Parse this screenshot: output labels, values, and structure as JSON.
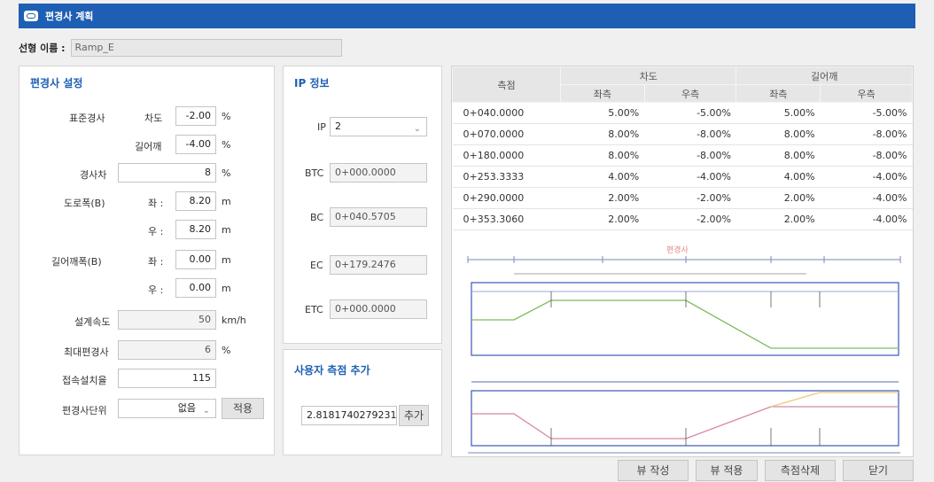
{
  "window": {
    "title": "편경사 계획",
    "icon": "app-logo-icon"
  },
  "route": {
    "label": "선형 이름 :",
    "value": "Ramp_E"
  },
  "settings": {
    "title": "편경사 설정",
    "standard_slope_label": "표준경사",
    "lane_label": "차도",
    "lane_value": "-2.00",
    "shoulder_label": "길어깨",
    "shoulder_value": "-4.00",
    "percent": "%",
    "slope_diff_label": "경사차",
    "slope_diff_value": "8",
    "road_width_label": "도로폭(B)",
    "left_label": "좌 :",
    "right_label": "우 :",
    "road_left_value": "8.20",
    "road_right_value": "8.20",
    "m": "m",
    "shoulder_width_label": "길어깨폭(B)",
    "shoulder_left_value": "0.00",
    "shoulder_right_value": "0.00",
    "design_speed_label": "설계속도",
    "design_speed_value": "50",
    "kmh": "km/h",
    "max_super_label": "최대편경사",
    "max_super_value": "6",
    "transition_label": "접속설치율",
    "transition_value": "115",
    "unit_label": "편경사단위",
    "unit_value": "없음",
    "apply_label": "적용"
  },
  "ip": {
    "title": "IP 정보",
    "ip_label": "IP",
    "ip_value": "2",
    "btc_label": "BTC",
    "btc_value": "0+000.0000",
    "bc_label": "BC",
    "bc_value": "0+040.5705",
    "ec_label": "EC",
    "ec_value": "0+179.2476",
    "etc_label": "ETC",
    "etc_value": "0+000.0000"
  },
  "user_station": {
    "title": "사용자 측점 추가",
    "value": "2.8181740279231",
    "add_label": "추가"
  },
  "table": {
    "station_header": "측점",
    "lane_header": "차도",
    "shoulder_header": "길어깨",
    "left_header": "좌측",
    "right_header": "우측",
    "rows": [
      {
        "station": "0+040.0000",
        "lane_left": "5.00%",
        "lane_right": "-5.00%",
        "sh_left": "5.00%",
        "sh_right": "-5.00%"
      },
      {
        "station": "0+070.0000",
        "lane_left": "8.00%",
        "lane_right": "-8.00%",
        "sh_left": "8.00%",
        "sh_right": "-8.00%"
      },
      {
        "station": "0+180.0000",
        "lane_left": "8.00%",
        "lane_right": "-8.00%",
        "sh_left": "8.00%",
        "sh_right": "-8.00%"
      },
      {
        "station": "0+253.3333",
        "lane_left": "4.00%",
        "lane_right": "-4.00%",
        "sh_left": "4.00%",
        "sh_right": "-4.00%"
      },
      {
        "station": "0+290.0000",
        "lane_left": "2.00%",
        "lane_right": "-2.00%",
        "sh_left": "2.00%",
        "sh_right": "-4.00%"
      },
      {
        "station": "0+353.3060",
        "lane_left": "2.00%",
        "lane_right": "-2.00%",
        "sh_left": "2.00%",
        "sh_right": "-4.00%"
      }
    ]
  },
  "diagram": {
    "title": "편경사"
  },
  "footer": {
    "create_view": "뷰 작성",
    "apply_view": "뷰 적용",
    "delete_station": "측점삭제",
    "close": "닫기"
  }
}
